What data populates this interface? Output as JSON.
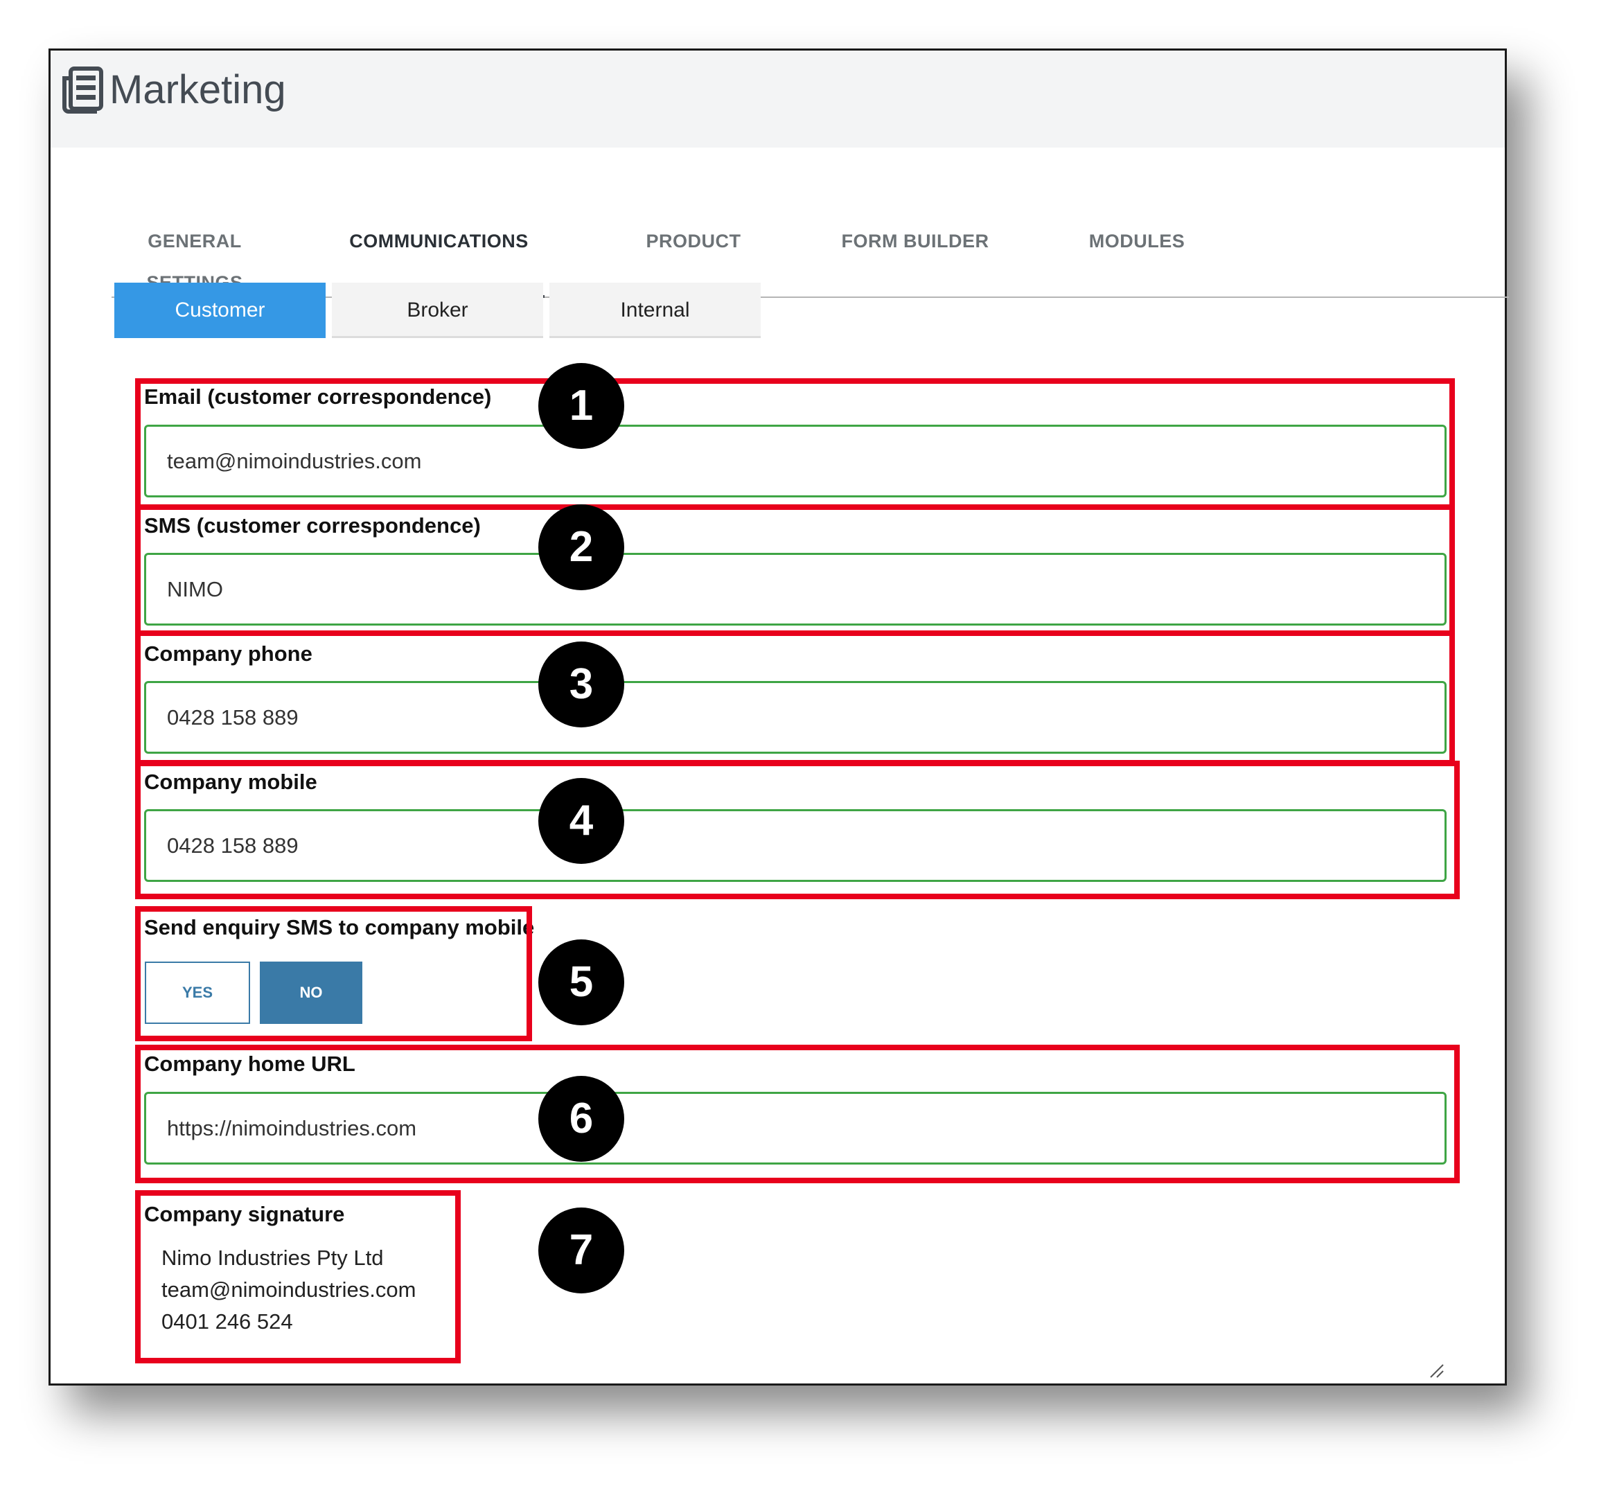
{
  "app": {
    "title": "Marketing",
    "icon": "newspaper-icon"
  },
  "main_tabs": [
    {
      "label": "GENERAL SETTINGS",
      "active": false
    },
    {
      "label": "COMMUNICATIONS",
      "active": true
    },
    {
      "label": "PRODUCT",
      "active": false
    },
    {
      "label": "FORM BUILDER",
      "active": false
    },
    {
      "label": "MODULES",
      "active": false
    }
  ],
  "sub_tabs": [
    {
      "label": "Customer",
      "active": true
    },
    {
      "label": "Broker",
      "active": false
    },
    {
      "label": "Internal",
      "active": false
    }
  ],
  "fields": {
    "email": {
      "label": "Email (customer correspondence)",
      "value": "team@nimoindustries.com"
    },
    "sms": {
      "label": "SMS (customer correspondence)",
      "value": "NIMO"
    },
    "phone": {
      "label": "Company phone",
      "value": "0428 158 889"
    },
    "mobile": {
      "label": "Company mobile",
      "value": "0428 158 889"
    },
    "send_sms": {
      "label": "Send enquiry SMS to company mobile",
      "yes": "YES",
      "no": "NO",
      "selected": "NO"
    },
    "url": {
      "label": "Company home URL",
      "value": "https://nimoindustries.com"
    },
    "signature": {
      "label": "Company signature",
      "lines": [
        "Nimo Industries Pty Ltd",
        "team@nimoindustries.com",
        "0401 246 524"
      ]
    }
  },
  "annotations": [
    "1",
    "2",
    "3",
    "4",
    "5",
    "6",
    "7"
  ],
  "colors": {
    "accent": "#3598e5",
    "toggle": "#3a7aa7",
    "input_border": "#3fa545",
    "highlight": "#e8001c",
    "header_bg": "#f3f4f5"
  }
}
